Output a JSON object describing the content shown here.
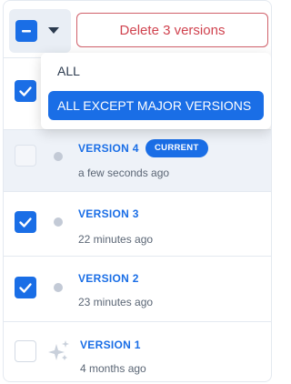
{
  "toolbar": {
    "delete_label": "Delete 3 versions"
  },
  "dropdown": {
    "items": [
      {
        "label": "ALL",
        "active": false
      },
      {
        "label": "ALL EXCEPT MAJOR VERSIONS",
        "active": true
      }
    ]
  },
  "versions": [
    {
      "label": "VERSION 4",
      "time": "a few seconds ago",
      "badge": "CURRENT",
      "checked": false,
      "icon": "dot-icon"
    },
    {
      "label": "VERSION 3",
      "time": "22 minutes ago",
      "checked": true,
      "icon": "dot-icon"
    },
    {
      "label": "VERSION 2",
      "time": "23 minutes ago",
      "checked": true,
      "icon": "dot-icon"
    },
    {
      "label": "VERSION 1",
      "time": "4 months ago",
      "checked": false,
      "icon": "sparkle-icon"
    }
  ],
  "colors": {
    "accent": "#1a6ee6",
    "danger": "#d0434f"
  }
}
